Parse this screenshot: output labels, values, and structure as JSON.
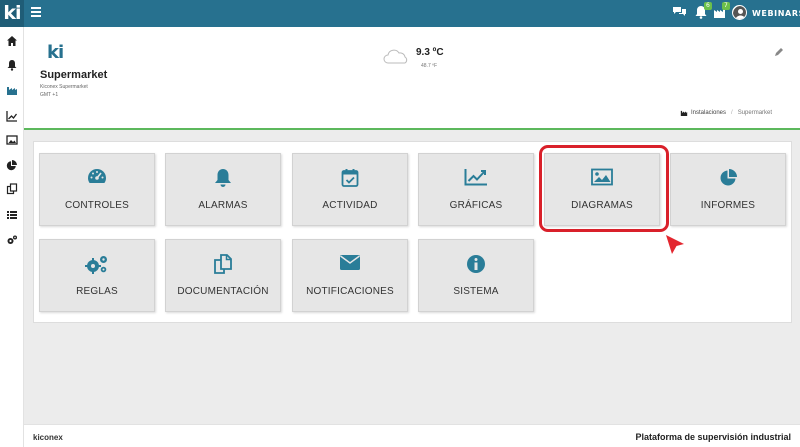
{
  "app": {
    "logo_text": "ki",
    "brand_color": "#27718f"
  },
  "topbar": {
    "chat_icon": "chat-icon",
    "alarm_icon": "bell-icon",
    "alarm_count": "6",
    "chart_icon": "chart-icon",
    "chart_count": "7",
    "user_name": "WEBINARS"
  },
  "sidebar": {
    "items": [
      {
        "icon": "home-icon"
      },
      {
        "icon": "bell-icon"
      },
      {
        "icon": "industry-icon",
        "active": true
      },
      {
        "icon": "line-chart-icon"
      },
      {
        "icon": "image-icon"
      },
      {
        "icon": "pie-chart-icon"
      },
      {
        "icon": "copy-icon"
      },
      {
        "icon": "list-icon"
      },
      {
        "icon": "cogs-icon"
      }
    ]
  },
  "header": {
    "client_logo": "ki",
    "client_name": "Supermarket",
    "client_sub": "Kiconex Supermarket",
    "timezone": "GMT +1",
    "weather": {
      "icon": "cloud-icon",
      "temp_c": "9.3 ºC",
      "temp_f": "48.7 ºF"
    },
    "breadcrumb": {
      "icon": "industry-icon",
      "first": "Instalaciones",
      "separator": "/",
      "current": "Supermarket"
    }
  },
  "tiles": [
    {
      "label": "CONTROLES",
      "icon": "dashboard-icon"
    },
    {
      "label": "ALARMAS",
      "icon": "bell-icon"
    },
    {
      "label": "ACTIVIDAD",
      "icon": "calendar-check-icon"
    },
    {
      "label": "GRÁFICAS",
      "icon": "line-chart-icon"
    },
    {
      "label": "DIAGRAMAS",
      "icon": "image-icon",
      "highlighted": true
    },
    {
      "label": "INFORMES",
      "icon": "pie-chart-icon"
    },
    {
      "label": "REGLAS",
      "icon": "cogs-icon"
    },
    {
      "label": "DOCUMENTACIÓN",
      "icon": "copy-icon"
    },
    {
      "label": "NOTIFICACIONES",
      "icon": "envelope-icon"
    },
    {
      "label": "SISTEMA",
      "icon": "info-icon"
    }
  ],
  "annotation": {
    "highlight_color": "#d9202a"
  },
  "footer": {
    "left": "kiconex",
    "right": "Plataforma de supervisión industrial"
  }
}
